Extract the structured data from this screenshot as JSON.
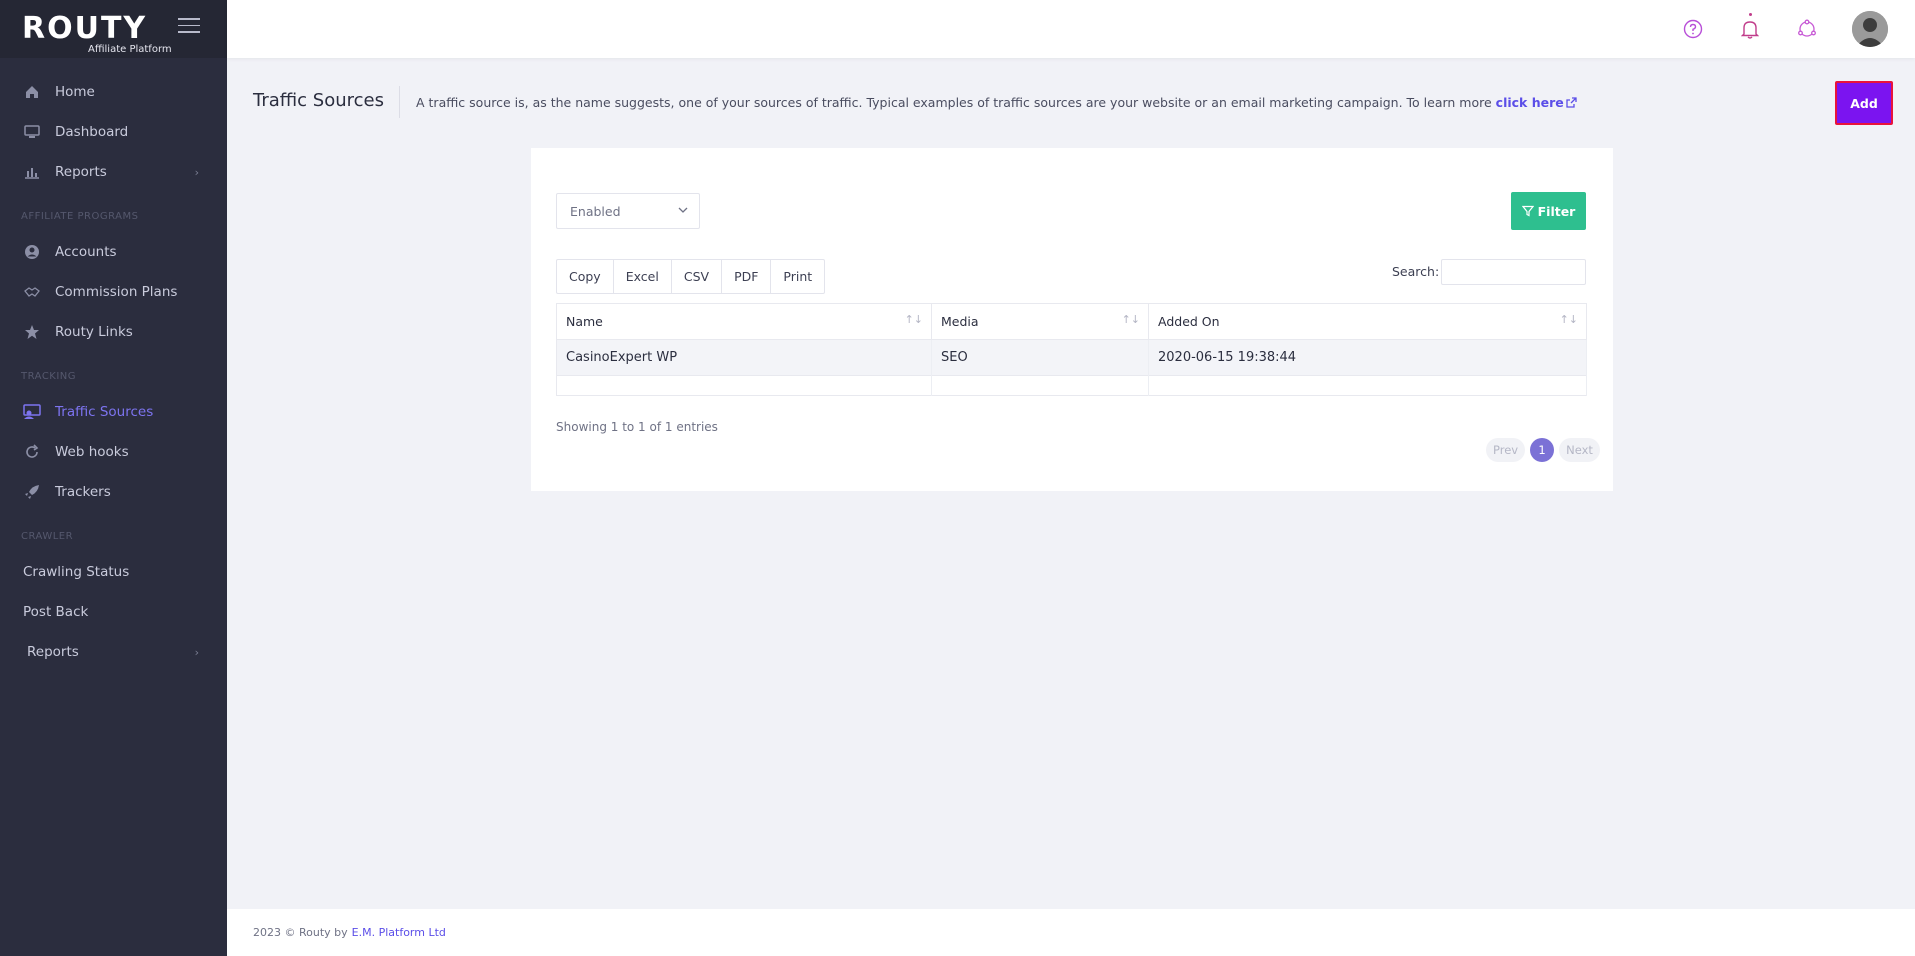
{
  "brand": {
    "logo_text": "ROUTY",
    "subtitle": "Affiliate Platform"
  },
  "sidebar": {
    "main": [
      {
        "label": "Home",
        "icon": "home-icon"
      },
      {
        "label": "Dashboard",
        "icon": "monitor-icon"
      },
      {
        "label": "Reports",
        "icon": "bar-chart-icon",
        "chevron": "›"
      }
    ],
    "sections": [
      {
        "title": "AFFILIATE PROGRAMS",
        "items": [
          {
            "label": "Accounts",
            "icon": "user-circle-icon"
          },
          {
            "label": "Commission Plans",
            "icon": "handshake-icon"
          },
          {
            "label": "Routy Links",
            "icon": "star-icon"
          }
        ]
      },
      {
        "title": "TRACKING",
        "items": [
          {
            "label": "Traffic Sources",
            "icon": "traffic-source-icon",
            "active": true
          },
          {
            "label": "Web hooks",
            "icon": "refresh-icon"
          },
          {
            "label": "Trackers",
            "icon": "rocket-icon"
          }
        ]
      },
      {
        "title": "CRAWLER",
        "items": [
          {
            "label": "Crawling Status"
          },
          {
            "label": "Post Back"
          },
          {
            "label": "Reports",
            "chevron": "›"
          }
        ]
      }
    ]
  },
  "header": {
    "title": "Traffic Sources",
    "description": "A traffic source is, as the name suggests, one of your sources of traffic. Typical examples of traffic sources are your website or an email marketing campaign. To learn more",
    "link_text": "click here",
    "add_label": "Add"
  },
  "filters": {
    "status_value": "Enabled",
    "filter_label": "Filter"
  },
  "export_buttons": [
    "Copy",
    "Excel",
    "CSV",
    "PDF",
    "Print"
  ],
  "search": {
    "label": "Search:",
    "placeholder": ""
  },
  "table": {
    "columns": [
      "Name",
      "Media",
      "Added On"
    ],
    "rows": [
      [
        "CasinoExpert WP",
        "SEO",
        "2020-06-15 19:38:44"
      ]
    ]
  },
  "pagination": {
    "info": "Showing 1 to 1 of 1 entries",
    "prev": "Prev",
    "current": "1",
    "next": "Next"
  },
  "footer": {
    "text": "2023 © Routy by",
    "link": "E.M. Platform Ltd"
  },
  "colors": {
    "accent": "#7b14f0",
    "filter": "#2ebf8f",
    "active_nav": "#7d74f0",
    "sidebar": "#2b2d3e"
  }
}
